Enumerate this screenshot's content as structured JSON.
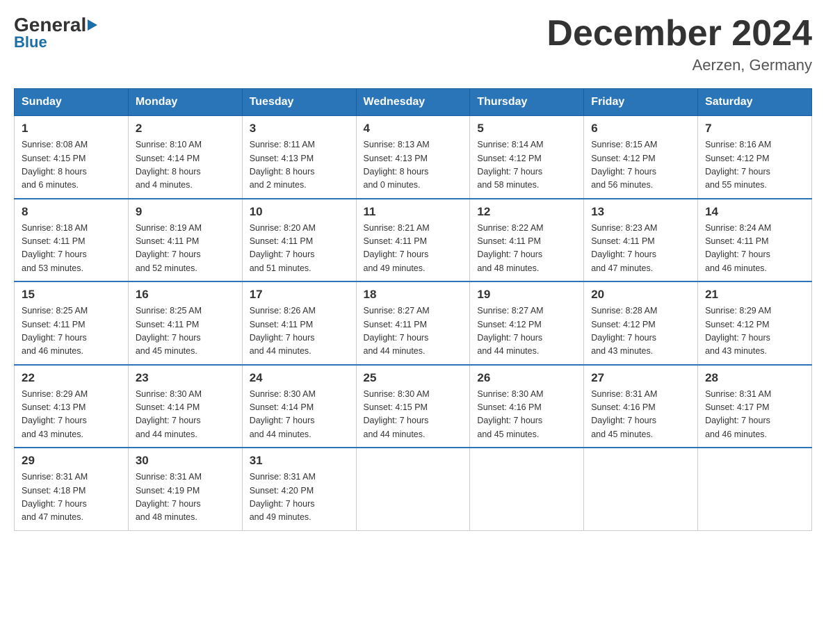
{
  "header": {
    "logo_general": "General",
    "logo_blue": "Blue",
    "month_title": "December 2024",
    "location": "Aerzen, Germany"
  },
  "weekdays": [
    "Sunday",
    "Monday",
    "Tuesday",
    "Wednesday",
    "Thursday",
    "Friday",
    "Saturday"
  ],
  "weeks": [
    [
      {
        "day": "1",
        "sunrise": "8:08 AM",
        "sunset": "4:15 PM",
        "daylight": "8 hours and 6 minutes."
      },
      {
        "day": "2",
        "sunrise": "8:10 AM",
        "sunset": "4:14 PM",
        "daylight": "8 hours and 4 minutes."
      },
      {
        "day": "3",
        "sunrise": "8:11 AM",
        "sunset": "4:13 PM",
        "daylight": "8 hours and 2 minutes."
      },
      {
        "day": "4",
        "sunrise": "8:13 AM",
        "sunset": "4:13 PM",
        "daylight": "8 hours and 0 minutes."
      },
      {
        "day": "5",
        "sunrise": "8:14 AM",
        "sunset": "4:12 PM",
        "daylight": "7 hours and 58 minutes."
      },
      {
        "day": "6",
        "sunrise": "8:15 AM",
        "sunset": "4:12 PM",
        "daylight": "7 hours and 56 minutes."
      },
      {
        "day": "7",
        "sunrise": "8:16 AM",
        "sunset": "4:12 PM",
        "daylight": "7 hours and 55 minutes."
      }
    ],
    [
      {
        "day": "8",
        "sunrise": "8:18 AM",
        "sunset": "4:11 PM",
        "daylight": "7 hours and 53 minutes."
      },
      {
        "day": "9",
        "sunrise": "8:19 AM",
        "sunset": "4:11 PM",
        "daylight": "7 hours and 52 minutes."
      },
      {
        "day": "10",
        "sunrise": "8:20 AM",
        "sunset": "4:11 PM",
        "daylight": "7 hours and 51 minutes."
      },
      {
        "day": "11",
        "sunrise": "8:21 AM",
        "sunset": "4:11 PM",
        "daylight": "7 hours and 49 minutes."
      },
      {
        "day": "12",
        "sunrise": "8:22 AM",
        "sunset": "4:11 PM",
        "daylight": "7 hours and 48 minutes."
      },
      {
        "day": "13",
        "sunrise": "8:23 AM",
        "sunset": "4:11 PM",
        "daylight": "7 hours and 47 minutes."
      },
      {
        "day": "14",
        "sunrise": "8:24 AM",
        "sunset": "4:11 PM",
        "daylight": "7 hours and 46 minutes."
      }
    ],
    [
      {
        "day": "15",
        "sunrise": "8:25 AM",
        "sunset": "4:11 PM",
        "daylight": "7 hours and 46 minutes."
      },
      {
        "day": "16",
        "sunrise": "8:25 AM",
        "sunset": "4:11 PM",
        "daylight": "7 hours and 45 minutes."
      },
      {
        "day": "17",
        "sunrise": "8:26 AM",
        "sunset": "4:11 PM",
        "daylight": "7 hours and 44 minutes."
      },
      {
        "day": "18",
        "sunrise": "8:27 AM",
        "sunset": "4:11 PM",
        "daylight": "7 hours and 44 minutes."
      },
      {
        "day": "19",
        "sunrise": "8:27 AM",
        "sunset": "4:12 PM",
        "daylight": "7 hours and 44 minutes."
      },
      {
        "day": "20",
        "sunrise": "8:28 AM",
        "sunset": "4:12 PM",
        "daylight": "7 hours and 43 minutes."
      },
      {
        "day": "21",
        "sunrise": "8:29 AM",
        "sunset": "4:12 PM",
        "daylight": "7 hours and 43 minutes."
      }
    ],
    [
      {
        "day": "22",
        "sunrise": "8:29 AM",
        "sunset": "4:13 PM",
        "daylight": "7 hours and 43 minutes."
      },
      {
        "day": "23",
        "sunrise": "8:30 AM",
        "sunset": "4:14 PM",
        "daylight": "7 hours and 44 minutes."
      },
      {
        "day": "24",
        "sunrise": "8:30 AM",
        "sunset": "4:14 PM",
        "daylight": "7 hours and 44 minutes."
      },
      {
        "day": "25",
        "sunrise": "8:30 AM",
        "sunset": "4:15 PM",
        "daylight": "7 hours and 44 minutes."
      },
      {
        "day": "26",
        "sunrise": "8:30 AM",
        "sunset": "4:16 PM",
        "daylight": "7 hours and 45 minutes."
      },
      {
        "day": "27",
        "sunrise": "8:31 AM",
        "sunset": "4:16 PM",
        "daylight": "7 hours and 45 minutes."
      },
      {
        "day": "28",
        "sunrise": "8:31 AM",
        "sunset": "4:17 PM",
        "daylight": "7 hours and 46 minutes."
      }
    ],
    [
      {
        "day": "29",
        "sunrise": "8:31 AM",
        "sunset": "4:18 PM",
        "daylight": "7 hours and 47 minutes."
      },
      {
        "day": "30",
        "sunrise": "8:31 AM",
        "sunset": "4:19 PM",
        "daylight": "7 hours and 48 minutes."
      },
      {
        "day": "31",
        "sunrise": "8:31 AM",
        "sunset": "4:20 PM",
        "daylight": "7 hours and 49 minutes."
      },
      null,
      null,
      null,
      null
    ]
  ]
}
